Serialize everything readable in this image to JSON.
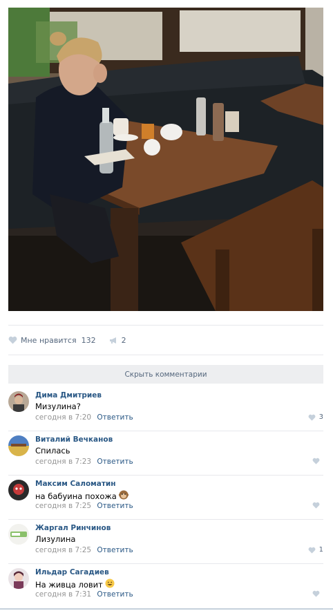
{
  "post": {
    "likes": {
      "label": "Мне нравится",
      "count": "132",
      "icon": "heart-icon"
    },
    "shares": {
      "count": "2",
      "icon": "megaphone-icon"
    },
    "hide_comments_label": "Скрыть комментарии"
  },
  "comments": [
    {
      "author": "Дима Дмитриев",
      "text": "Мизулина?",
      "time": "сегодня в 7:20",
      "reply": "Ответить",
      "likes": "3"
    },
    {
      "author": "Виталий Вечканов",
      "text": "Спилась",
      "time": "сегодня в 7:23",
      "reply": "Ответить",
      "likes": ""
    },
    {
      "author": "Максим Саломатин",
      "text": "на бабуина похожа",
      "emoji": "monkey-emoji",
      "time": "сегодня в 7:25",
      "reply": "Ответить",
      "likes": ""
    },
    {
      "author": "Жаргал Ринчинов",
      "text": "Лизулина",
      "time": "сегодня в 7:25",
      "reply": "Ответить",
      "likes": "1"
    },
    {
      "author": "Ильдар Сагадиев",
      "text": "На живца ловит",
      "emoji": "grinning-emoji",
      "time": "сегодня в 7:31",
      "reply": "Ответить",
      "likes": ""
    }
  ],
  "colors": {
    "link": "#2a5885",
    "muted": "#939393",
    "action": "#55677d",
    "bar": "#edeef0"
  }
}
